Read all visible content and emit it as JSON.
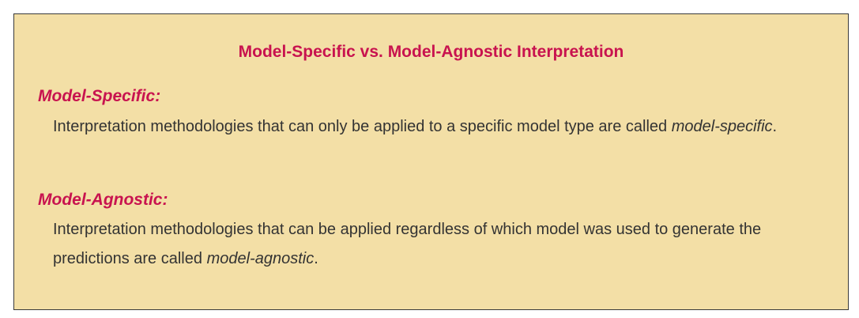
{
  "title": "Model-Specific vs. Model-Agnostic Interpretation",
  "sections": [
    {
      "heading": "Model-Specific:",
      "text_before": "Interpretation methodologies that can only be applied to a specific model type are called ",
      "term": "model-specific",
      "text_after": "."
    },
    {
      "heading": "Model-Agnostic:",
      "text_before": "Interpretation methodologies that can be applied regardless of which model was used to generate the predictions are called ",
      "term": "model-agnostic",
      "text_after": "."
    }
  ],
  "colors": {
    "background": "#f3dfa6",
    "accent": "#c8134f",
    "text": "#333333",
    "border": "#3a3a3a"
  }
}
